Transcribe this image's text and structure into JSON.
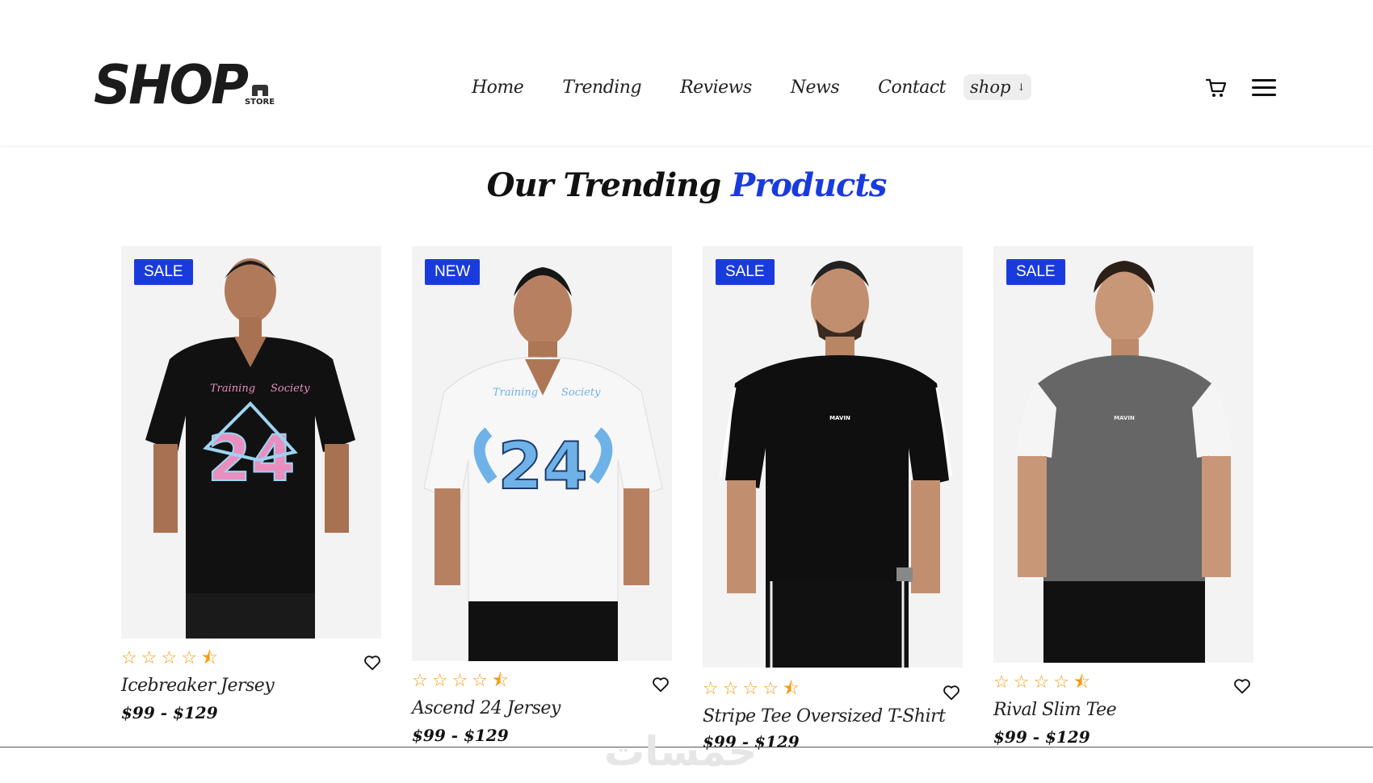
{
  "brand": {
    "logo": "SHOP",
    "sub": "STORE"
  },
  "nav": {
    "items": [
      "Home",
      "Trending",
      "Reviews",
      "News",
      "Contact"
    ],
    "dropdown_label": "shop",
    "dropdown_arrow": "↓"
  },
  "section": {
    "title_main": "Our Trending",
    "title_accent": "Products"
  },
  "colors": {
    "accent": "#1a3bdb",
    "star": "#f59a12",
    "photo_bg": "#f3f3f3"
  },
  "products": [
    {
      "badge": "SALE",
      "name": "Icebreaker Jersey",
      "price": "$99 - $129",
      "rating": 4.5,
      "shirt_color": "#111111",
      "print_number": "24",
      "print_color": "#e98fc0"
    },
    {
      "badge": "NEW",
      "name": "Ascend 24 Jersey",
      "price": "$99 - $129",
      "rating": 4.5,
      "shirt_color": "#f7f7f7",
      "print_number": "24",
      "print_color": "#6fb2e8"
    },
    {
      "badge": "SALE",
      "name": "Stripe Tee Oversized T-Shirt",
      "price": "$99 - $129",
      "rating": 4.5,
      "shirt_color": "#0f0f0f",
      "print_text": "MAVIN"
    },
    {
      "badge": "SALE",
      "name": "Rival Slim Tee",
      "price": "$99 - $129",
      "rating": 4.5,
      "shirt_color": "#666666",
      "sleeve_color": "#f5f5f5",
      "print_text": "MAVIN"
    }
  ],
  "watermark": "خمسات"
}
